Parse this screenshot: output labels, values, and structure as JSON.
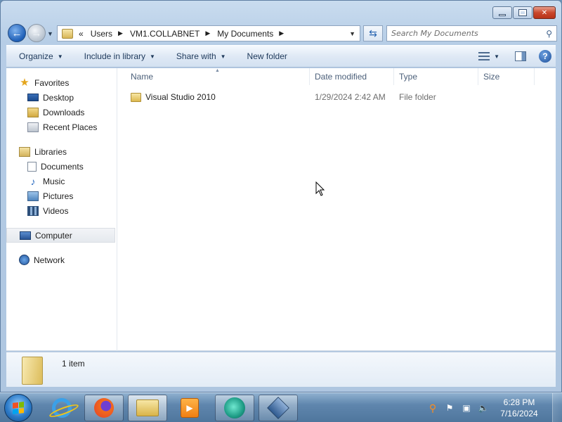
{
  "window": {
    "caption_buttons": [
      "minimize",
      "maximize",
      "close"
    ]
  },
  "address_bar": {
    "overflow": "«",
    "crumbs": [
      "Users",
      "VM1.COLLABNET",
      "My Documents"
    ]
  },
  "search": {
    "placeholder": "Search My Documents"
  },
  "toolbar": {
    "organize": "Organize",
    "include_in_library": "Include in library",
    "share_with": "Share with",
    "new_folder": "New folder",
    "help": "?"
  },
  "nav_pane": {
    "favorites": {
      "label": "Favorites",
      "items": [
        "Desktop",
        "Downloads",
        "Recent Places"
      ]
    },
    "libraries": {
      "label": "Libraries",
      "items": [
        "Documents",
        "Music",
        "Pictures",
        "Videos"
      ]
    },
    "computer": "Computer",
    "network": "Network"
  },
  "columns": [
    "Name",
    "Date modified",
    "Type",
    "Size"
  ],
  "files": [
    {
      "name": "Visual Studio 2010",
      "date_modified": "1/29/2024 2:42 AM",
      "type": "File folder",
      "size": ""
    }
  ],
  "details": {
    "count": "1 item"
  },
  "taskbar": {
    "apps": [
      "internet-explorer",
      "firefox",
      "windows-explorer",
      "media-player",
      "cyan-app",
      "virtualbox"
    ],
    "clock": {
      "time": "6:28 PM",
      "date": "7/16/2024"
    }
  },
  "colors": {
    "accent": "#2563b0",
    "folder": "#ddb94f",
    "taskbar": "#5f86ad"
  }
}
